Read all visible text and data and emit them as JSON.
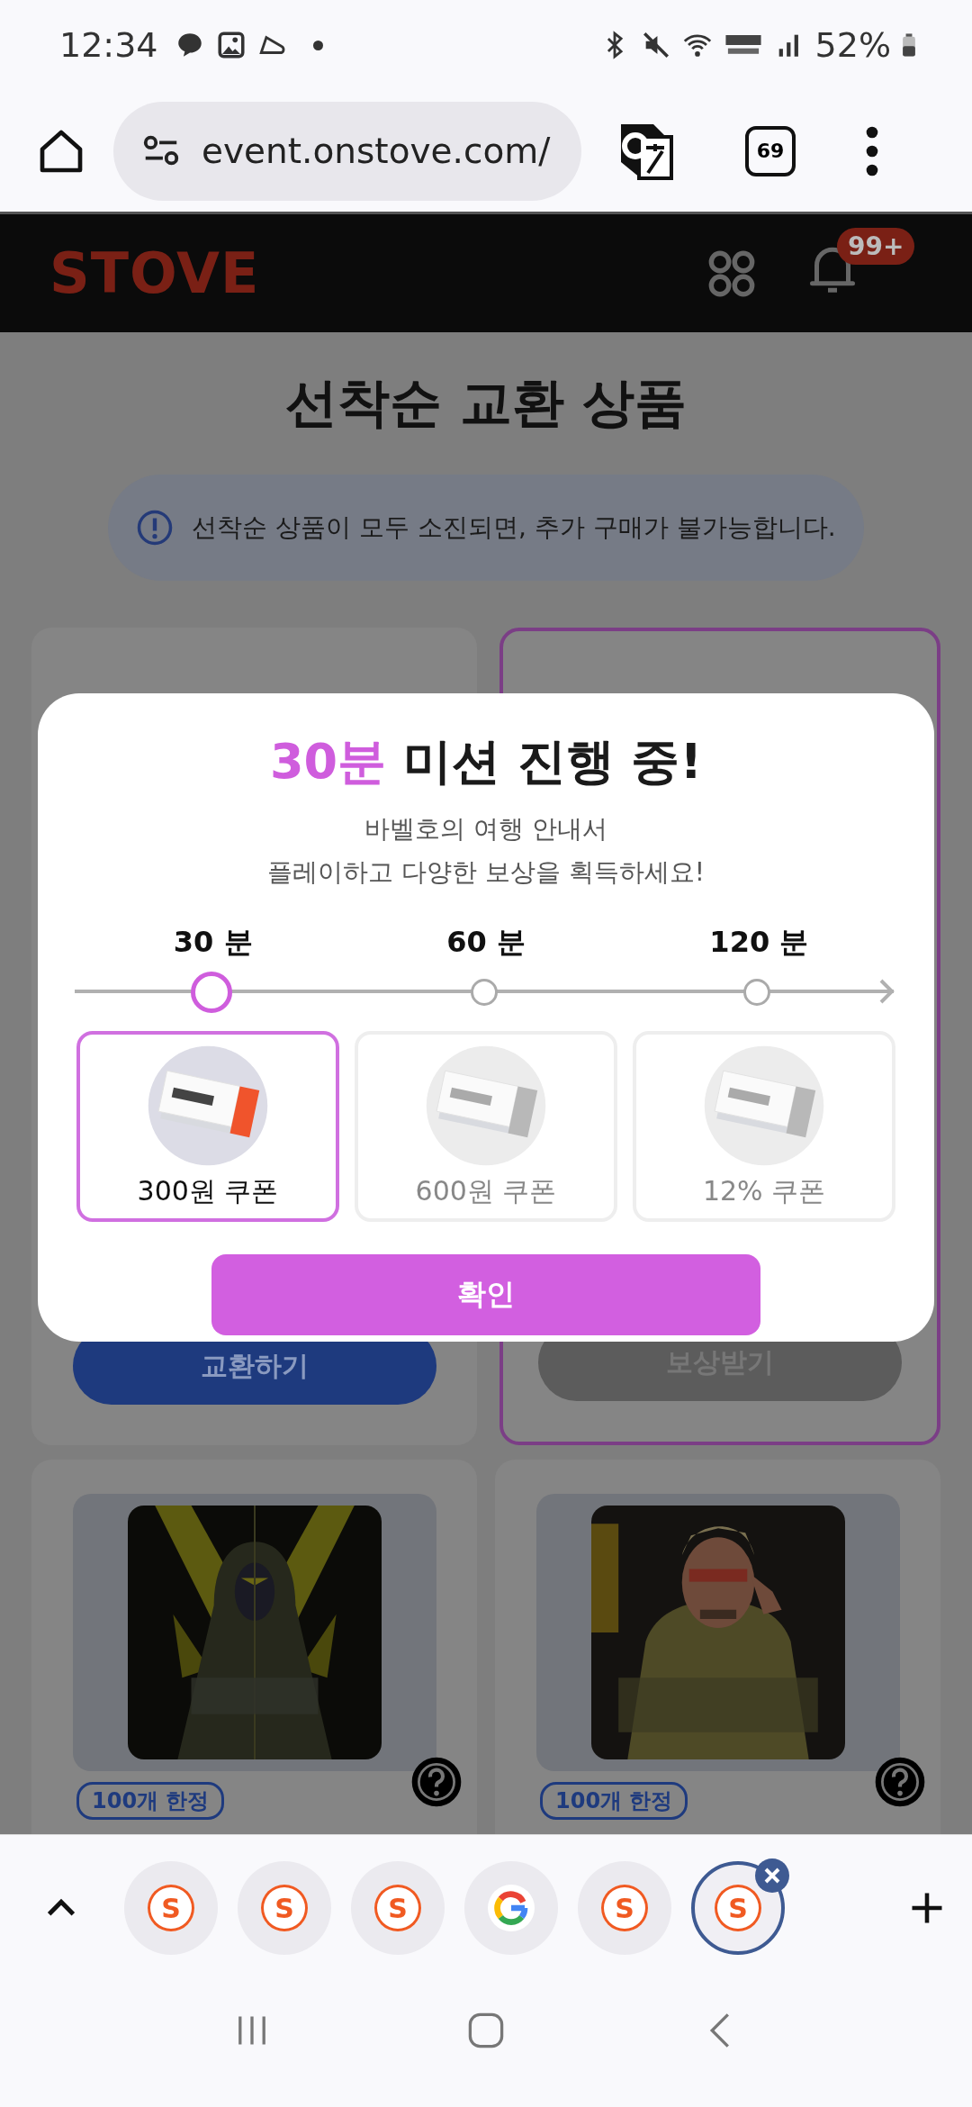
{
  "status_bar": {
    "time": "12:34",
    "battery": "52%"
  },
  "browser": {
    "url": "event.onstove.com/",
    "tab_count": "69"
  },
  "site_header": {
    "logo": "STOVE",
    "notification_badge": "99+"
  },
  "page": {
    "title": "선착순 교환 상품",
    "notice": "선착순 상품이 모두 소진되면, 추가 구매가 불가능합니다.",
    "cards": [
      {
        "button": "교환하기",
        "selected": false,
        "disabled": false
      },
      {
        "button": "보상받기",
        "selected": true,
        "disabled": true
      }
    ],
    "products": [
      {
        "kind": "picture",
        "tag": "100개 한정"
      },
      {
        "kind": "picture",
        "tag": "100개 한정"
      }
    ]
  },
  "modal": {
    "title_highlight": "30분",
    "title": "미션 진행 중!",
    "description": [
      "바벨호의 여행 안내서",
      "플레이하고 다양한 보상을 획득하세요!"
    ],
    "milestones": [
      {
        "label": "30 분",
        "selected": true
      },
      {
        "label": "60 분",
        "selected": false
      },
      {
        "label": "120 분",
        "selected": false
      }
    ],
    "rewards": [
      {
        "label": "300원 쿠폰",
        "selected": true
      },
      {
        "label": "600원 쿠폰",
        "selected": false
      },
      {
        "label": "12% 쿠폰",
        "selected": false
      }
    ],
    "confirm": "확인"
  },
  "tab_strip": {
    "tabs": [
      {
        "kind": "site",
        "icon": "S",
        "selected": false
      },
      {
        "kind": "site",
        "icon": "S",
        "selected": false
      },
      {
        "kind": "site",
        "icon": "S",
        "selected": false
      },
      {
        "kind": "google",
        "selected": false
      },
      {
        "kind": "site",
        "icon": "S",
        "selected": false
      },
      {
        "kind": "site",
        "icon": "S",
        "selected": true
      }
    ]
  }
}
